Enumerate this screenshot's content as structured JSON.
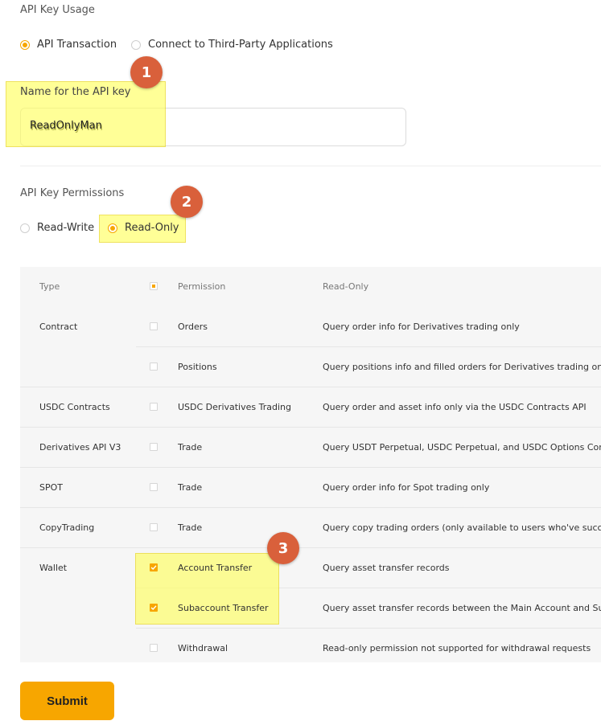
{
  "usage": {
    "title": "API Key Usage",
    "option_transaction": "API Transaction",
    "option_third_party": "Connect to Third-Party Applications"
  },
  "name_field": {
    "label": "Name for the API key",
    "value": "ReadOnlyMan"
  },
  "permissions": {
    "title": "API Key Permissions",
    "option_read_write": "Read-Write",
    "option_read_only": "Read-Only"
  },
  "badges": [
    "1",
    "2",
    "3"
  ],
  "table": {
    "headers": {
      "type": "Type",
      "permission": "Permission",
      "read_only": "Read-Only"
    },
    "rows": [
      {
        "type": "Contract",
        "permission": "Orders",
        "desc": "Query order info for Derivatives trading only",
        "checked": false
      },
      {
        "type": "",
        "permission": "Positions",
        "desc": "Query positions info and filled orders for Derivatives trading only",
        "checked": false
      },
      {
        "type": "USDC Contracts",
        "permission": "USDC Derivatives Trading",
        "desc": "Query order and asset info only via the USDC Contracts API",
        "checked": false
      },
      {
        "type": "Derivatives API V3",
        "permission": "Trade",
        "desc": "Query USDT Perpetual, USDC Perpetual, and USDC Options Cont",
        "checked": false
      },
      {
        "type": "SPOT",
        "permission": "Trade",
        "desc": "Query order info for Spot trading only",
        "checked": false
      },
      {
        "type": "CopyTrading",
        "permission": "Trade",
        "desc": "Query copy trading orders (only available to users who've succes",
        "checked": false
      },
      {
        "type": "Wallet",
        "permission": "Account Transfer",
        "desc": "Query asset transfer records",
        "checked": true
      },
      {
        "type": "",
        "permission": "Subaccount Transfer",
        "desc": "Query asset transfer records between the Main Account and Sub",
        "checked": true
      },
      {
        "type": "",
        "permission": "Withdrawal",
        "desc": "Read-only permission not supported for withdrawal requests",
        "checked": false
      }
    ]
  },
  "submit_label": "Submit",
  "colors": {
    "accent": "#f7a600",
    "badge": "#d9603b",
    "highlight": "#ffff60"
  }
}
